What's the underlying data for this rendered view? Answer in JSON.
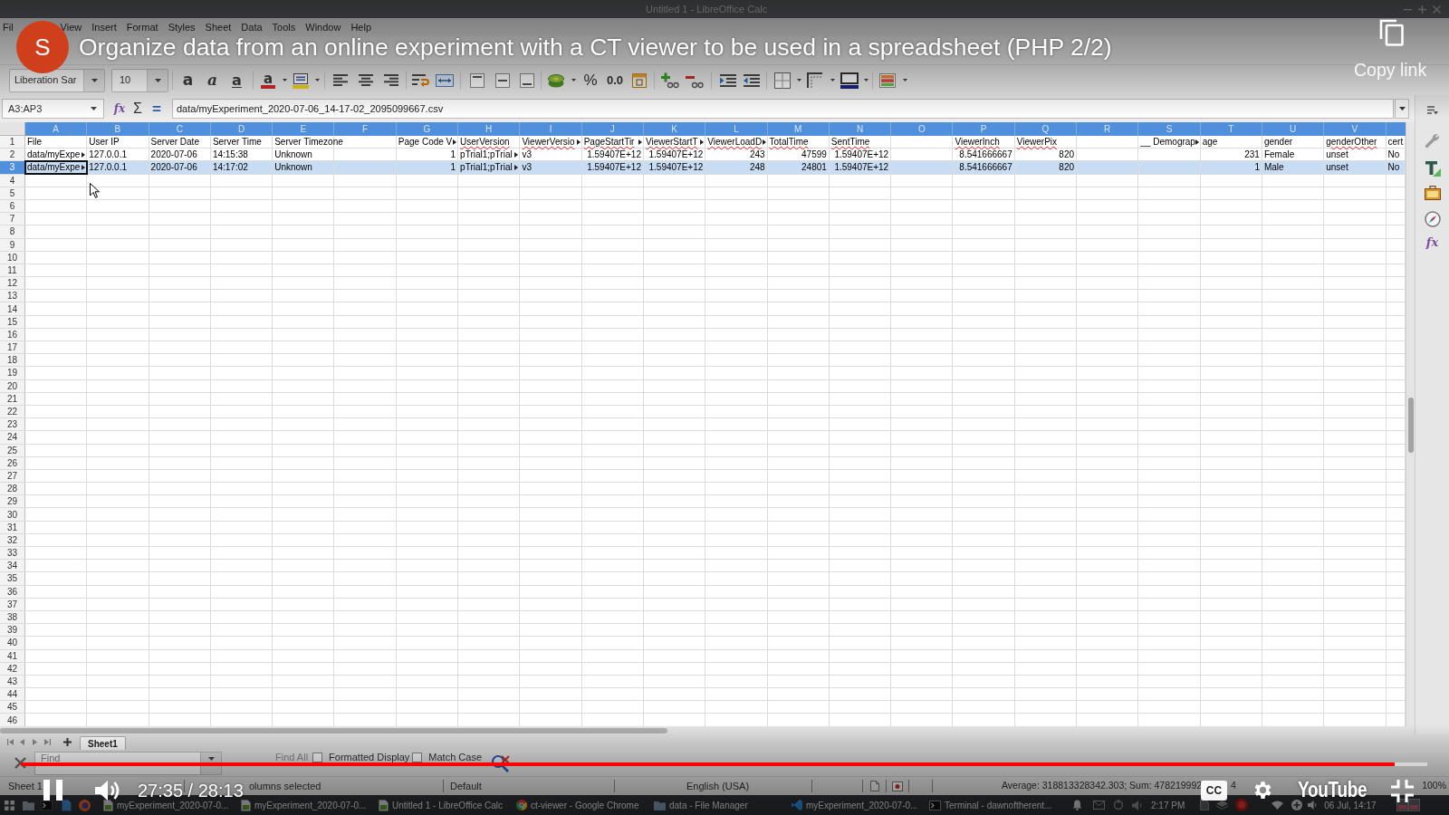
{
  "video_player": {
    "channel_initial": "S",
    "title": "Organize data from an online experiment with a CT viewer to be used in a spreadsheet (PHP 2/2)",
    "copy_link": "Copy link",
    "progress": {
      "level": 0.977
    },
    "time": "27:35 / 28:13",
    "captions": "CC",
    "logo": "YouTube"
  },
  "window": {
    "title": "Untitled 1 - LibreOffice Calc"
  },
  "menu": [
    "Fil",
    "View",
    "Insert",
    "Format",
    "Styles",
    "Sheet",
    "Data",
    "Tools",
    "Window",
    "Help"
  ],
  "formatting_toolbar": {
    "font_name": "Liberation Sar",
    "font_size": "10",
    "bold_glyph": "a",
    "italic_glyph": "a",
    "underline_glyph": "a",
    "font_color_glyph": "a",
    "percent_glyph": "%",
    "decimal_glyph": "0.0"
  },
  "formula_bar": {
    "name_box": "A3:AP3",
    "function_glyph": "fx",
    "sum_glyph": "Σ",
    "equals_glyph": "=",
    "content": "data/myExperiment_2020-07-06_14-17-02_2095099667.csv"
  },
  "sidebar": {
    "functions_glyph": "fx"
  },
  "sheet": {
    "columns": [
      "A",
      "B",
      "C",
      "D",
      "E",
      "F",
      "G",
      "H",
      "I",
      "J",
      "K",
      "L",
      "M",
      "N",
      "O",
      "P",
      "Q",
      "R",
      "S",
      "T",
      "U",
      "V"
    ],
    "rows": [
      {
        "number": "1",
        "selected": false,
        "cursor": false,
        "cells": [
          {
            "text": "File",
            "kind": "text",
            "misspelled": false
          },
          {
            "text": "User IP",
            "kind": "text",
            "misspelled": false
          },
          {
            "text": "Server Date",
            "kind": "text",
            "misspelled": false
          },
          {
            "text": "Server Time",
            "kind": "text",
            "misspelled": false
          },
          {
            "text": "Server Timezone",
            "kind": "text",
            "misspelled": false
          },
          null,
          {
            "text": "Page Code V",
            "kind": "clipped",
            "misspelled": false
          },
          {
            "text": "UserVersion",
            "kind": "text",
            "misspelled": true
          },
          {
            "text": "ViewerVersio",
            "kind": "clipped",
            "misspelled": true
          },
          {
            "text": "PageStartTir",
            "kind": "clipped",
            "misspelled": true
          },
          {
            "text": "ViewerStartT",
            "kind": "clipped",
            "misspelled": true
          },
          {
            "text": "ViewerLoadD",
            "kind": "clipped",
            "misspelled": true
          },
          {
            "text": "TotalTime",
            "kind": "text",
            "misspelled": true
          },
          {
            "text": "SentTime",
            "kind": "text",
            "misspelled": true
          },
          null,
          {
            "text": "ViewerInch",
            "kind": "text",
            "misspelled": true
          },
          {
            "text": "ViewerPix",
            "kind": "text",
            "misspelled": true
          },
          null,
          {
            "text": "__ Demograp",
            "kind": "clipped",
            "misspelled": false
          },
          {
            "text": "age",
            "kind": "text",
            "misspelled": false
          },
          {
            "text": "gender",
            "kind": "text",
            "misspelled": false
          },
          {
            "text": "genderOther",
            "kind": "text",
            "misspelled": true
          },
          {
            "text": "cert",
            "kind": "text",
            "misspelled": false
          }
        ]
      },
      {
        "number": "2",
        "selected": false,
        "cursor": false,
        "cells": [
          {
            "text": "data/myExpe",
            "kind": "clipped",
            "misspelled": false
          },
          {
            "text": "127.0.0.1",
            "kind": "text",
            "misspelled": false
          },
          {
            "text": "2020-07-06",
            "kind": "text",
            "misspelled": false
          },
          {
            "text": "14:15:38",
            "kind": "text",
            "misspelled": false
          },
          {
            "text": "Unknown",
            "kind": "text",
            "misspelled": false
          },
          null,
          {
            "text": "1",
            "kind": "number",
            "misspelled": false
          },
          {
            "text": "pTrial1;pTrial",
            "kind": "clipped",
            "misspelled": false
          },
          {
            "text": "v3",
            "kind": "text",
            "misspelled": false
          },
          {
            "text": "1.59407E+12",
            "kind": "number",
            "misspelled": false
          },
          {
            "text": "1.59407E+12",
            "kind": "number",
            "misspelled": false
          },
          {
            "text": "243",
            "kind": "number",
            "misspelled": false
          },
          {
            "text": "47599",
            "kind": "number",
            "misspelled": false
          },
          {
            "text": "1.59407E+12",
            "kind": "number",
            "misspelled": false
          },
          null,
          {
            "text": "8.541666667",
            "kind": "number",
            "misspelled": false
          },
          {
            "text": "820",
            "kind": "number",
            "misspelled": false
          },
          null,
          null,
          {
            "text": "231",
            "kind": "number",
            "misspelled": false
          },
          {
            "text": "Female",
            "kind": "text",
            "misspelled": false
          },
          {
            "text": "unset",
            "kind": "text",
            "misspelled": false
          },
          {
            "text": "No",
            "kind": "text",
            "misspelled": false
          }
        ]
      },
      {
        "number": "3",
        "selected": true,
        "cursor": true,
        "cells": [
          {
            "text": "data/myExpe",
            "kind": "clipped",
            "misspelled": false
          },
          {
            "text": "127.0.0.1",
            "kind": "text",
            "misspelled": false
          },
          {
            "text": "2020-07-06",
            "kind": "text",
            "misspelled": false
          },
          {
            "text": "14:17:02",
            "kind": "text",
            "misspelled": false
          },
          {
            "text": "Unknown",
            "kind": "text",
            "misspelled": false
          },
          null,
          {
            "text": "1",
            "kind": "number",
            "misspelled": false
          },
          {
            "text": "pTrial1;pTrial",
            "kind": "clipped",
            "misspelled": false
          },
          {
            "text": "v3",
            "kind": "text",
            "misspelled": false
          },
          {
            "text": "1.59407E+12",
            "kind": "number",
            "misspelled": false
          },
          {
            "text": "1.59407E+12",
            "kind": "number",
            "misspelled": false
          },
          {
            "text": "248",
            "kind": "number",
            "misspelled": false
          },
          {
            "text": "24801",
            "kind": "number",
            "misspelled": false
          },
          {
            "text": "1.59407E+12",
            "kind": "number",
            "misspelled": false
          },
          null,
          {
            "text": "8.541666667",
            "kind": "number",
            "misspelled": false
          },
          {
            "text": "820",
            "kind": "number",
            "misspelled": false
          },
          null,
          null,
          {
            "text": "1",
            "kind": "number",
            "misspelled": false
          },
          {
            "text": "Male",
            "kind": "text",
            "misspelled": false
          },
          {
            "text": "unset",
            "kind": "text",
            "misspelled": false
          },
          {
            "text": "No",
            "kind": "text",
            "misspelled": false
          }
        ]
      }
    ],
    "empty_rows": [
      "4",
      "5",
      "6",
      "7",
      "8",
      "9",
      "10",
      "11",
      "12",
      "13",
      "14",
      "15",
      "16",
      "17",
      "18",
      "19",
      "20",
      "21",
      "22",
      "23",
      "24",
      "25",
      "26",
      "27",
      "28",
      "29",
      "30",
      "31",
      "32",
      "33",
      "34",
      "35",
      "36",
      "37",
      "38",
      "39",
      "40",
      "41",
      "42",
      "43",
      "44",
      "45",
      "46"
    ]
  },
  "sheet_tabs": [
    {
      "label": "Sheet1",
      "selected": true
    }
  ],
  "find_bar": {
    "placeholder": "Find",
    "find_all": {
      "label": "Find All",
      "disabled": true
    },
    "options": [
      {
        "label": "Formatted Display",
        "checked": false
      },
      {
        "label": "Match Case",
        "checked": false
      }
    ]
  },
  "status_bar": {
    "sheet": "Sheet 1",
    "selection": "olumns selected",
    "page_style": "Default",
    "language": "English (USA)",
    "summary": "Average: 318813328342.303; Sum: 478219992",
    "summary_tail": "4",
    "zoom": "100%"
  },
  "taskbar": {
    "windows": [
      {
        "label": "myExperiment_2020-07-0...",
        "kind": "document"
      },
      {
        "label": "myExperiment_2020-07-0...",
        "kind": "document"
      },
      {
        "label": "Untitled 1 - LibreOffice Calc",
        "kind": "document"
      },
      {
        "label": "ct-viewer - Google Chrome",
        "kind": "browser"
      },
      {
        "label": "data - File Manager",
        "kind": "folder"
      },
      {
        "label": "myExperiment_2020-07-0...",
        "kind": "editor"
      },
      {
        "label": "Terminal - dawnoftherent...",
        "kind": "terminal"
      }
    ],
    "time": "2:17 PM",
    "date": "06 Jul, 14:17"
  }
}
